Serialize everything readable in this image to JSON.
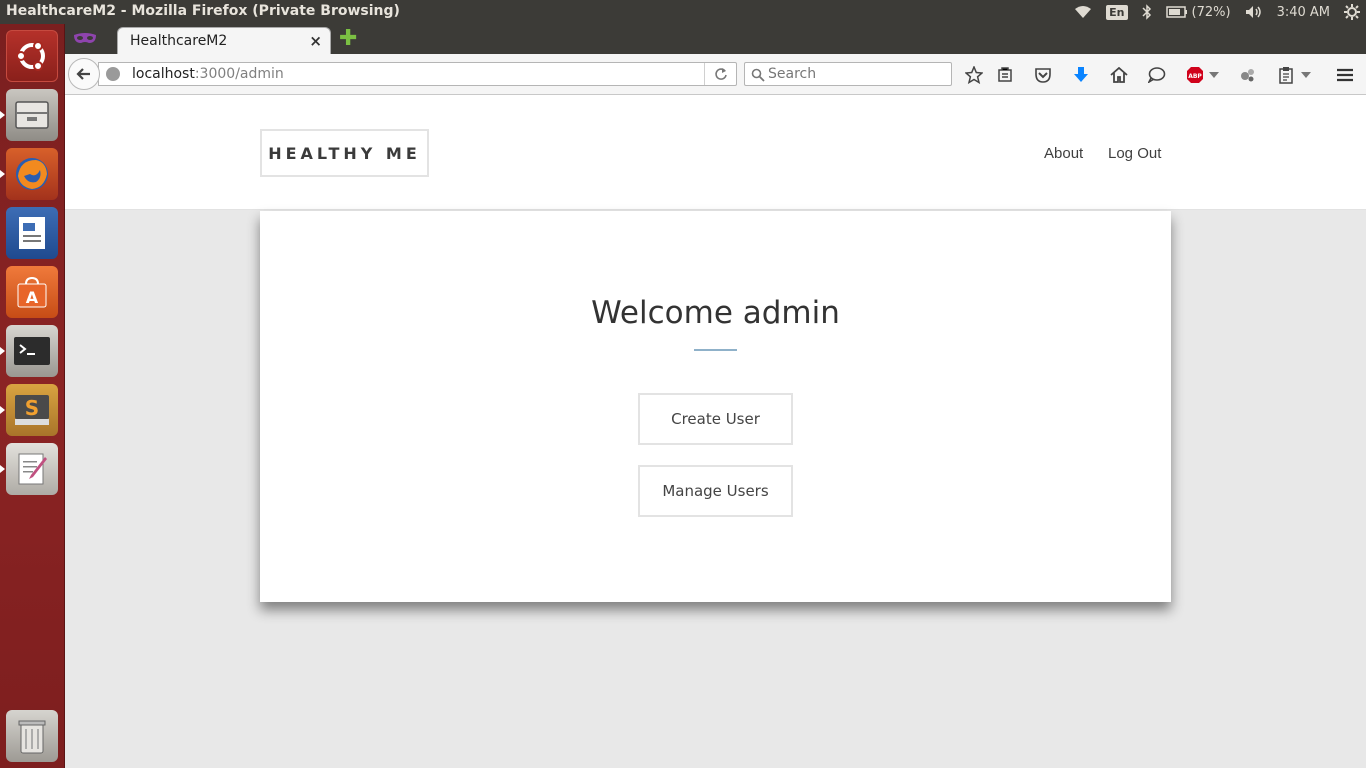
{
  "window": {
    "title": "HealthcareM2 - Mozilla Firefox (Private Browsing)"
  },
  "system_tray": {
    "keyboard_layout": "En",
    "battery": "(72%)",
    "clock": "3:40 AM"
  },
  "launcher": {
    "items": [
      {
        "icon": "ubuntu-dash-icon"
      },
      {
        "icon": "file-manager-icon"
      },
      {
        "icon": "firefox-icon"
      },
      {
        "icon": "writer-icon"
      },
      {
        "icon": "software-center-icon"
      },
      {
        "icon": "terminal-icon"
      },
      {
        "icon": "sublime-text-icon"
      },
      {
        "icon": "text-editor-icon"
      },
      {
        "icon": "trash-icon"
      }
    ]
  },
  "browser": {
    "tab": {
      "title": "HealthcareM2"
    },
    "url": {
      "host": "localhost",
      "path": ":3000/admin"
    },
    "search": {
      "placeholder": "Search"
    },
    "colors": {
      "abp": "#d0021b",
      "download_arrow": "#0a84ff"
    }
  },
  "site": {
    "logo": "HEALTHY ME",
    "nav": {
      "about": "About",
      "logout": "Log Out"
    }
  },
  "main": {
    "heading": "Welcome admin",
    "buttons": {
      "create_user": "Create User",
      "manage_users": "Manage Users"
    },
    "accent_color": "#8fb1c9"
  }
}
